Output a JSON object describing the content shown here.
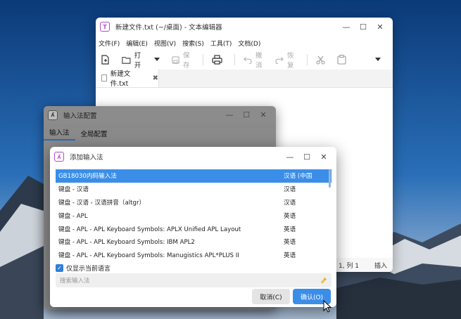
{
  "editor": {
    "title": "新建文件.txt (~/桌面) - 文本编辑器",
    "icon": "text-editor-icon",
    "menu": [
      "文件(F)",
      "编辑(E)",
      "视图(V)",
      "搜索(S)",
      "工具(T)",
      "文档(D)"
    ],
    "toolbar": {
      "open_label": "打开",
      "save_label": "保存",
      "undo_label": "撤消",
      "redo_label": "恢复"
    },
    "tab_label": "新建文件.txt",
    "status": {
      "position": "1, 列 1",
      "mode": "插入"
    }
  },
  "imconfig": {
    "title": "输入法配置",
    "tabs": [
      "输入法",
      "全局配置"
    ]
  },
  "addim": {
    "title": "添加输入法",
    "rows": [
      {
        "name": "GB18030内码输入法",
        "lang": "汉语 (中国"
      },
      {
        "name": "键盘 - 汉语",
        "lang": "汉语"
      },
      {
        "name": "键盘 - 汉语 - 汉语拼音（altgr）",
        "lang": "汉语"
      },
      {
        "name": "键盘 - APL",
        "lang": "英语"
      },
      {
        "name": "键盘 - APL - APL Keyboard Symbols: APLX Unified APL Layout",
        "lang": "英语"
      },
      {
        "name": "键盘 - APL - APL Keyboard Symbols: IBM APL2",
        "lang": "英语"
      },
      {
        "name": "键盘 - APL - APL Keyboard Symbols: Manugistics APL*PLUS II",
        "lang": "英语"
      }
    ],
    "checkbox_label": "仅显示当前语言",
    "search_placeholder": "搜索输入法",
    "cancel_label": "取消(C)",
    "ok_label": "确认(O)"
  },
  "colors": {
    "accent": "#3b8ee8",
    "wallpaper_sky": "#1d5ca3"
  }
}
